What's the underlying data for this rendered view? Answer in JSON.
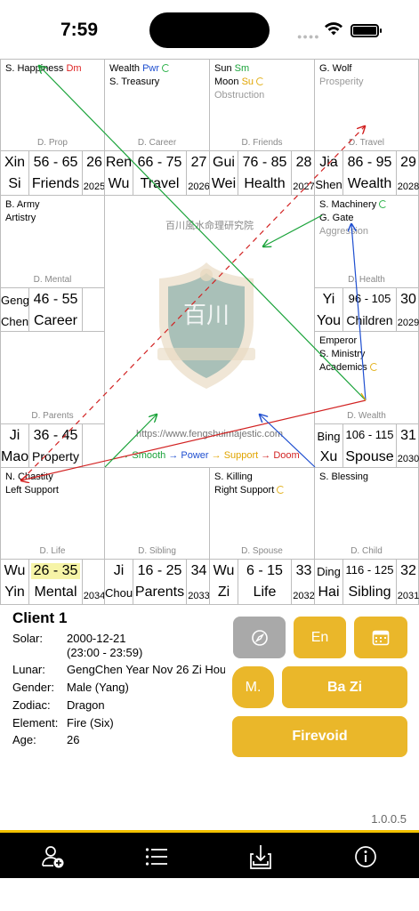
{
  "status": {
    "time": "7:59"
  },
  "palaces": [
    {
      "id": "prop",
      "stars": [
        [
          {
            "t": "S. Happiness "
          },
          {
            "t": "Dm",
            "c": "red"
          }
        ]
      ],
      "name": "D. Prop"
    },
    {
      "id": "career",
      "stars": [
        [
          {
            "t": "Wealth "
          },
          {
            "t": "Pwr",
            "c": "blue"
          },
          {
            "ring": "green"
          }
        ],
        [
          {
            "t": "S. Treasury"
          }
        ]
      ],
      "name": "D. Career"
    },
    {
      "id": "friends",
      "stars": [
        [
          {
            "t": "Sun "
          },
          {
            "t": "Sm",
            "c": "green"
          }
        ],
        [
          {
            "t": "Moon "
          },
          {
            "t": "Su",
            "c": "orange"
          },
          {
            "ring": "orange"
          }
        ],
        [
          {
            "t": "Obstruction",
            "c": "grey"
          }
        ]
      ],
      "name": "D. Friends"
    },
    {
      "id": "travel",
      "stars": [
        [
          {
            "t": "G. Wolf"
          }
        ],
        [
          {
            "t": "Prosperity",
            "c": "grey"
          }
        ]
      ],
      "name": "D. Travel"
    },
    {
      "id": "mental",
      "stars": [
        [
          {
            "t": "B. Army"
          }
        ],
        [
          {
            "t": "Artistry"
          }
        ]
      ],
      "name": "D. Mental"
    },
    {
      "id": "health",
      "stars": [
        [
          {
            "t": "S. Machinery"
          },
          {
            "ring": "green"
          }
        ],
        [
          {
            "t": "G. Gate"
          }
        ],
        [
          {
            "t": "Aggression",
            "c": "grey"
          }
        ]
      ],
      "name": "D. Health"
    },
    {
      "id": "parents",
      "stars": [],
      "name": "D. Parents"
    },
    {
      "id": "wealth",
      "stars": [
        [
          {
            "t": "Emperor"
          }
        ],
        [
          {
            "t": "S. Ministry"
          }
        ],
        [
          {
            "t": "Academics"
          },
          {
            "ring": "orange"
          }
        ]
      ],
      "name": "D. Wealth"
    },
    {
      "id": "life",
      "stars": [
        [
          {
            "t": "N. Chastity"
          }
        ],
        [
          {
            "t": "Left Support"
          }
        ]
      ],
      "name": "D. Life"
    },
    {
      "id": "sibling",
      "stars": [],
      "name": "D. Sibling"
    },
    {
      "id": "spouse",
      "stars": [
        [
          {
            "t": "S. Killing"
          }
        ],
        [
          {
            "t": "Right Support"
          },
          {
            "ring": "orange"
          }
        ]
      ],
      "name": "D. Spouse"
    },
    {
      "id": "child",
      "stars": [
        [
          {
            "t": "S. Blessing"
          }
        ]
      ],
      "name": "D. Child"
    }
  ],
  "infos": [
    {
      "id": "prop",
      "s1": "Xin",
      "s2": "Si",
      "r": "56 - 65",
      "p": "Friends",
      "a": "26",
      "y": "2025"
    },
    {
      "id": "career",
      "s1": "Ren",
      "s2": "Wu",
      "r": "66 - 75",
      "p": "Travel",
      "a": "27",
      "y": "2026"
    },
    {
      "id": "friends",
      "s1": "Gui",
      "s2": "Wei",
      "r": "76 - 85",
      "p": "Health",
      "a": "28",
      "y": "2027"
    },
    {
      "id": "travel",
      "s1": "Jia",
      "s2": "Shen",
      "r": "86 - 95",
      "p": "Wealth",
      "a": "29",
      "y": "2028"
    },
    {
      "id": "mental",
      "s1": "Geng",
      "s2": "Chen",
      "r": "46 - 55",
      "p": "Career",
      "a": "",
      "y": ""
    },
    {
      "id": "health",
      "s1": "Yi",
      "s2": "You",
      "r": "96 - 105",
      "p": "Children",
      "a": "30",
      "y": "2029"
    },
    {
      "id": "parents",
      "s1": "Ji",
      "s2": "Mao",
      "r": "36 - 45",
      "p": "Property",
      "a": "",
      "y": ""
    },
    {
      "id": "wealth",
      "s1": "Bing",
      "s2": "Xu",
      "r": "106 - 115",
      "p": "Spouse",
      "a": "31",
      "y": "2030"
    },
    {
      "id": "life",
      "s1": "Wu",
      "s2": "Yin",
      "r": "26 - 35",
      "p": "Mental",
      "a": "",
      "y": "2034"
    },
    {
      "id": "sibling",
      "s1": "Ji",
      "s2": "Chou",
      "r": "16 - 25",
      "p": "Parents",
      "a": "34",
      "y": "2033"
    },
    {
      "id": "spouse",
      "s1": "Wu",
      "s2": "Zi",
      "r": "6 - 15",
      "p": "Life",
      "a": "33",
      "y": "2032"
    },
    {
      "id": "child",
      "s1": "Ding",
      "s2": "Hai",
      "r": "116 - 125",
      "p": "Sibling",
      "a": "32",
      "y": "2031"
    }
  ],
  "center": {
    "institute": "百川風水命理研究院",
    "logo_text": "百川",
    "url": "https://www.fengshuimajestic.com",
    "legend": {
      "smooth": "→ Smooth",
      "power": "→ Power",
      "support": "→ Support",
      "doom": "→ Doom",
      "colors": {
        "smooth": "#1aa33a",
        "power": "#1f4fd0",
        "support": "#e0a400",
        "doom": "#d22222"
      }
    }
  },
  "client": {
    "name": "Client 1",
    "fields": [
      {
        "k": "Solar:",
        "v": "2000-12-21",
        "v2": "(23:00 - 23:59)"
      },
      {
        "k": "Lunar:",
        "v": "GengChen Year Nov 26 Zi Hour"
      },
      {
        "k": "Gender:",
        "v": "Male (Yang)"
      },
      {
        "k": "Zodiac:",
        "v": "Dragon"
      },
      {
        "k": "Element:",
        "v": "Fire (Six)"
      },
      {
        "k": "Age:",
        "v": "26"
      }
    ]
  },
  "buttons": {
    "compass_icon": "compass-icon",
    "lang": "En",
    "calendar_icon": "calendar-icon",
    "mode": "M.",
    "bazi": "Ba Zi",
    "firevoid": "Firevoid"
  },
  "version": "1.0.0.5",
  "tabs": [
    "add-user-icon",
    "list-icon",
    "download-icon",
    "info-icon"
  ],
  "accent": "#eab72a"
}
